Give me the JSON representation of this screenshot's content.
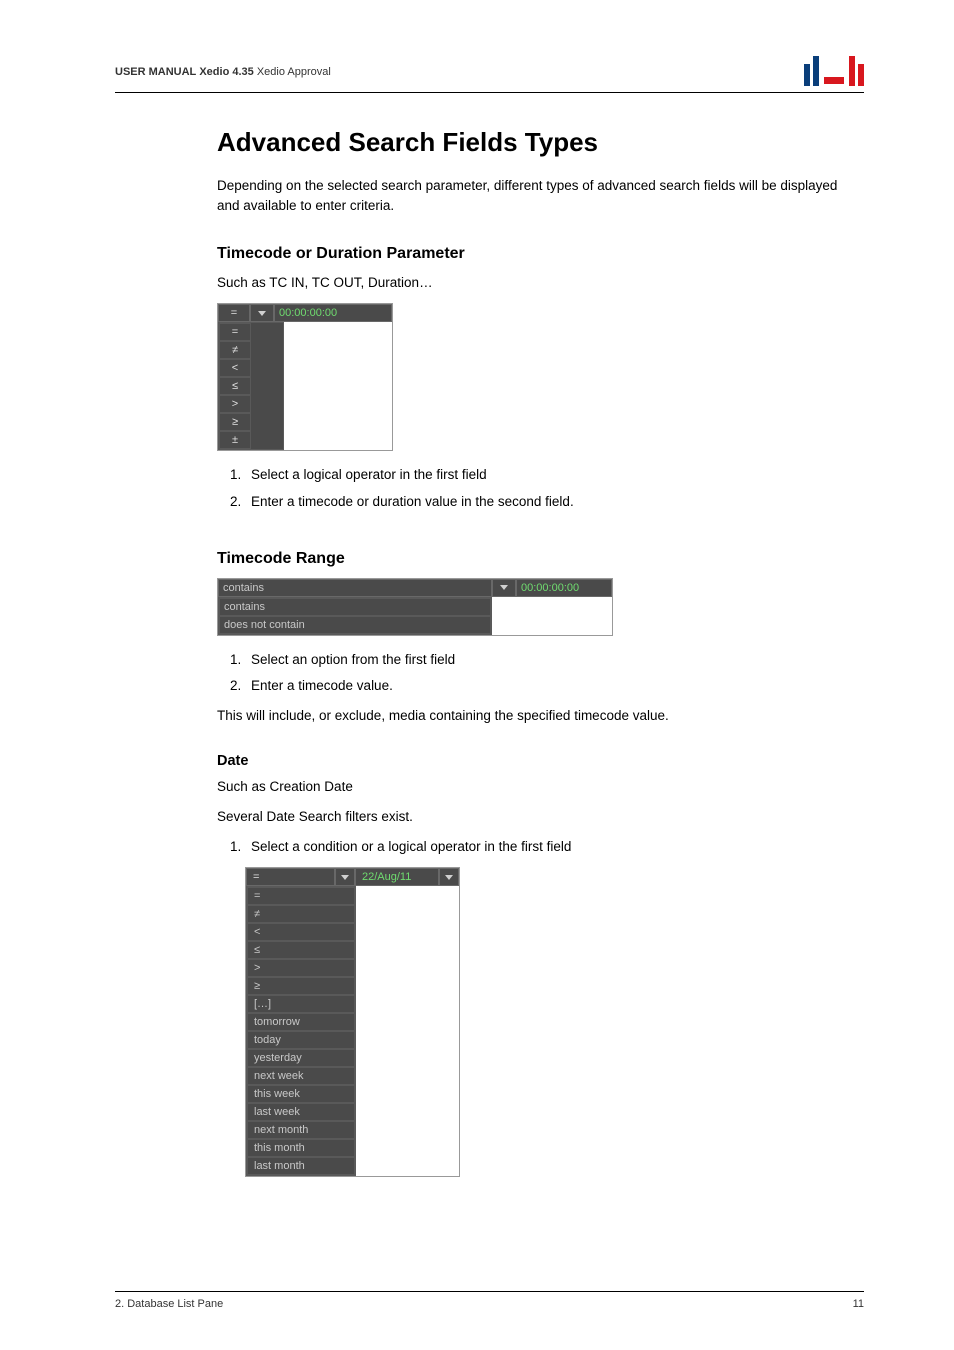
{
  "header": {
    "manual_label": "USER MANUAL",
    "product": "Xedio 4.35",
    "module": "Xedio Approval"
  },
  "h1": "Advanced Search Fields Types",
  "intro": "Depending on the selected search parameter, different types of advanced search fields will be displayed and available to enter criteria.",
  "section1": {
    "title": "Timecode or Duration Parameter",
    "lead": "Such as TC IN, TC OUT, Duration…",
    "tc_value": "00:00:00:00",
    "eq": "=",
    "ops": [
      "=",
      "≠",
      "<",
      "≤",
      ">",
      "≥",
      "±"
    ],
    "step1": "Select a logical operator in the first field",
    "step2": "Enter a timecode or duration value in the second field."
  },
  "section2": {
    "title": "Timecode Range",
    "selected": "contains",
    "tc_value": "00:00:00:00",
    "opts": [
      "contains",
      "does not contain"
    ],
    "step1": "Select an option from the first field",
    "step2": "Enter a timecode value.",
    "closing": "This will include, or exclude, media containing the specified timecode value."
  },
  "section3": {
    "title": "Date",
    "lead1": "Such as Creation Date",
    "lead2": "Several Date Search filters exist.",
    "step1": "Select a condition or a logical operator in the first field",
    "eq": "=",
    "date_value": "22/Aug/11",
    "opts": [
      "=",
      "≠",
      "<",
      "≤",
      ">",
      "≥",
      "[…]",
      "tomorrow",
      "today",
      "yesterday",
      "next week",
      "this week",
      "last week",
      "next month",
      "this month",
      "last month"
    ]
  },
  "footer": {
    "left": "2. Database List Pane",
    "right": "11"
  }
}
